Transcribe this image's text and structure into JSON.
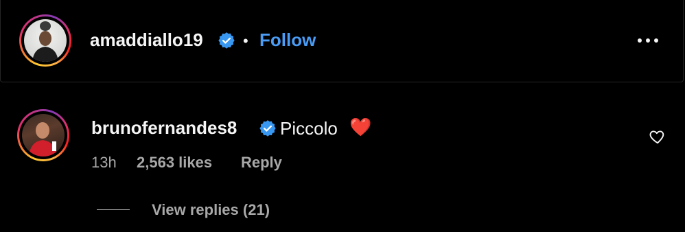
{
  "post_header": {
    "username": "amaddiallo19",
    "separator": "•",
    "follow_label": "Follow",
    "more_icon": "more-horizontal-icon"
  },
  "comment": {
    "username": "brunofernandes8",
    "text": "Piccolo",
    "emoji": "❤️",
    "time": "13h",
    "likes": "2,563 likes",
    "reply_label": "Reply",
    "like_icon": "heart-outline-icon"
  },
  "replies": {
    "label": "View replies (21)"
  },
  "colors": {
    "background": "#000000",
    "text": "#f5f5f5",
    "muted": "#a8a8a8",
    "link": "#4a9cf5",
    "verified": "#3897f0"
  }
}
